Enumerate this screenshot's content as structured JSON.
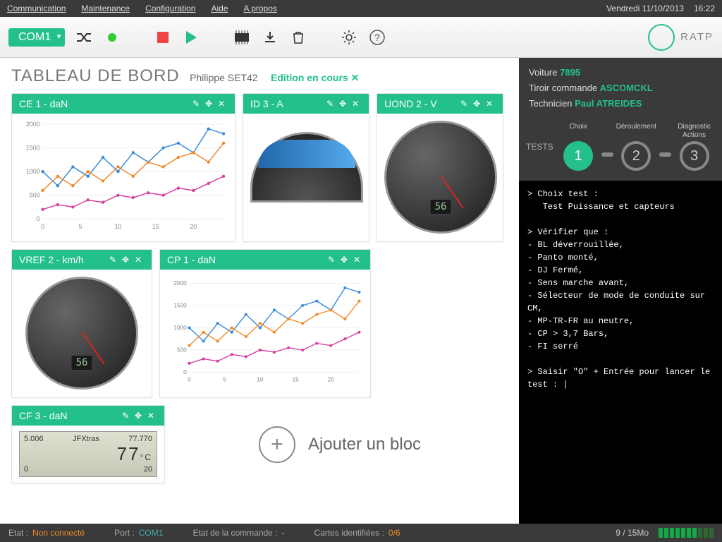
{
  "menu": {
    "items": [
      "Communication",
      "Maintenance",
      "Configuration",
      "Aide",
      "A propos"
    ],
    "date": "Vendredi 11/10/2013",
    "time": "16:22"
  },
  "toolbar": {
    "port": "COM1",
    "brand": "RATP"
  },
  "dash": {
    "title": "TABLEAU DE BORD",
    "user": "Philippe SET42",
    "editing": "Edition en cours",
    "cards": {
      "ce1": "CE 1 - daN",
      "id3": "ID 3 - A",
      "uond2": "UOND 2 - V",
      "vref2": "VREF 2 - km/h",
      "cp1": "CP 1 - daN",
      "cf3": "CF 3 - daN"
    },
    "gauge_uond2": {
      "value": "56"
    },
    "gauge_vref2": {
      "value": "56"
    },
    "lcd": {
      "tl": "5.006",
      "tc": "JFXtras",
      "tr": "77.770",
      "big": "77",
      "unit": "°C",
      "bl": "0",
      "br": "20"
    },
    "add": "Ajouter un bloc"
  },
  "sidebar": {
    "voiture_lbl": "Voiture",
    "voiture": "7895",
    "tiroir_lbl": "Tiroir commande",
    "tiroir": "ASCOMCKL",
    "tech_lbl": "Technicien",
    "tech": "Paul ATREIDES",
    "tests_lbl": "TESTS",
    "steps": [
      {
        "n": "1",
        "name": "Choix"
      },
      {
        "n": "2",
        "name": "Déroulement"
      },
      {
        "n": "3",
        "name": "Diagnostic Actions"
      }
    ]
  },
  "terminal": "> Choix test :\n   Test Puissance et capteurs\n\n> Vérifier que :\n- BL déverrouillée,\n- Panto monté,\n- DJ Fermé,\n- Sens marche avant,\n- Sélecteur de mode de conduite sur CM,\n- MP-TR-FR au neutre,\n- CP > 3,7 Bars,\n- FI serré\n\n> Saisir \"O\" + Entrée pour lancer le test : |",
  "status": {
    "etat_lbl": "Etat :",
    "etat": "Non connecté",
    "port_lbl": "Port :",
    "port": "COM1",
    "cmd_lbl": "Etat de la commande :",
    "cmd": "-",
    "cartes_lbl": "Cartes identifiées :",
    "cartes": "0/6",
    "mem": "9 / 15Mo"
  },
  "chart_data": [
    {
      "type": "line",
      "card": "ce1",
      "x": [
        0,
        2,
        4,
        6,
        8,
        10,
        12,
        14,
        16,
        18,
        20,
        22,
        24
      ],
      "series": [
        {
          "name": "blue",
          "values": [
            1000,
            700,
            1100,
            900,
            1300,
            1000,
            1400,
            1200,
            1500,
            1600,
            1400,
            1900,
            1800
          ]
        },
        {
          "name": "orange",
          "values": [
            600,
            900,
            700,
            1000,
            800,
            1100,
            900,
            1200,
            1100,
            1300,
            1400,
            1200,
            1600
          ]
        },
        {
          "name": "pink",
          "values": [
            200,
            300,
            250,
            400,
            350,
            500,
            450,
            550,
            500,
            650,
            600,
            750,
            900
          ]
        }
      ],
      "ylim": [
        0,
        2000
      ],
      "yticks": [
        0,
        500,
        1000,
        1500,
        2000
      ],
      "xticks": [
        0,
        5,
        10,
        15,
        20
      ]
    },
    {
      "type": "line",
      "card": "cp1",
      "x": [
        0,
        2,
        4,
        6,
        8,
        10,
        12,
        14,
        16,
        18,
        20,
        22,
        24
      ],
      "series": [
        {
          "name": "blue",
          "values": [
            1000,
            700,
            1100,
            900,
            1300,
            1000,
            1400,
            1200,
            1500,
            1600,
            1400,
            1900,
            1800
          ]
        },
        {
          "name": "orange",
          "values": [
            600,
            900,
            700,
            1000,
            800,
            1100,
            900,
            1200,
            1100,
            1300,
            1400,
            1200,
            1600
          ]
        },
        {
          "name": "pink",
          "values": [
            200,
            300,
            250,
            400,
            350,
            500,
            450,
            550,
            500,
            650,
            600,
            750,
            900
          ]
        }
      ],
      "ylim": [
        0,
        2000
      ],
      "yticks": [
        0,
        500,
        1000,
        1500,
        2000
      ],
      "xticks": [
        0,
        5,
        10,
        15,
        20
      ]
    },
    {
      "type": "gauge",
      "card": "id3",
      "range": [
        0,
        80
      ],
      "value": 40
    },
    {
      "type": "gauge",
      "card": "uond2",
      "range": [
        0,
        80
      ],
      "value": 56
    },
    {
      "type": "gauge",
      "card": "vref2",
      "range": [
        0,
        80
      ],
      "value": 56
    },
    {
      "type": "lcd",
      "card": "cf3",
      "value": 77,
      "unit": "°C",
      "min": 5.006,
      "max": 77.77
    }
  ]
}
